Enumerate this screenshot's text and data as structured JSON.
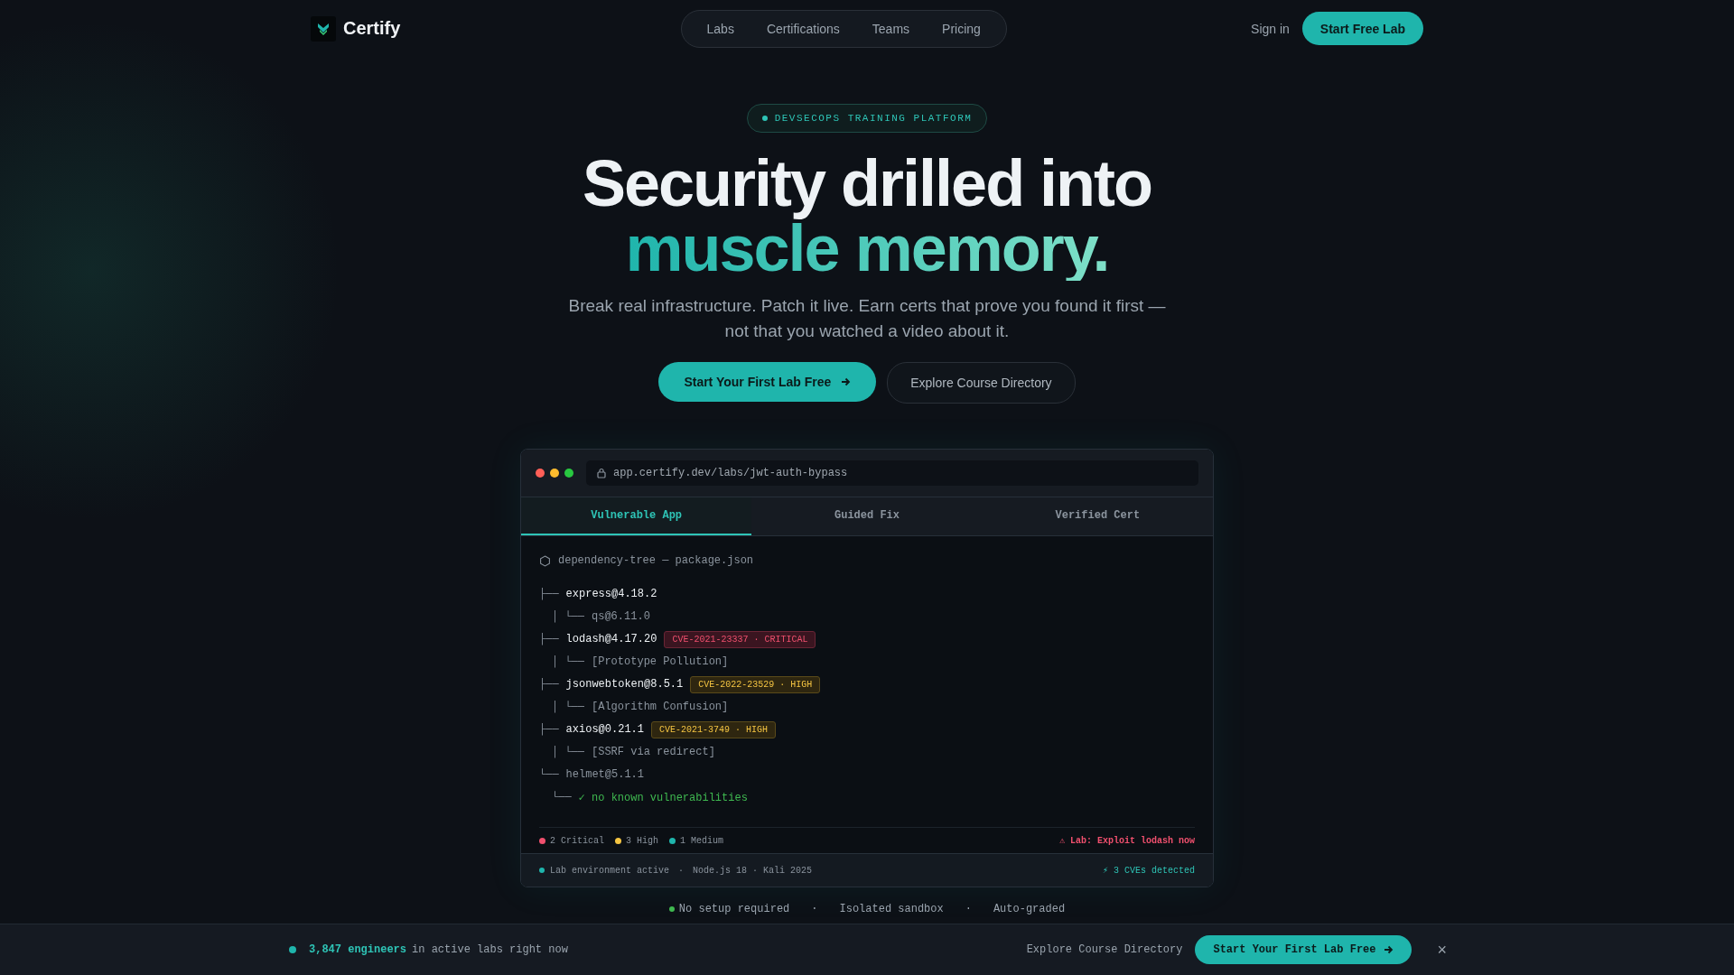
{
  "nav": {
    "brand": "Certify",
    "links": [
      "Labs",
      "Certifications",
      "Teams",
      "Pricing"
    ],
    "sign_in": "Sign in",
    "cta": "Start Free Lab"
  },
  "hero": {
    "badge": "DEVSECOPS TRAINING PLATFORM",
    "title_line1": "Security drilled into",
    "title_line2": "muscle memory.",
    "subtitle": "Break real infrastructure. Patch it live. Earn certs that prove you found it first — not that you watched a video about it.",
    "primary_button": "Start Your First Lab Free",
    "secondary_button": "Explore Course Directory"
  },
  "browser": {
    "url": "app.certify.dev/labs/jwt-auth-bypass",
    "tabs": [
      {
        "label": "Vulnerable App",
        "selected": true
      },
      {
        "label": "Guided Fix",
        "selected": false
      },
      {
        "label": "Verified Cert",
        "selected": false
      }
    ],
    "file_header": "dependency-tree — package.json",
    "tree": [
      {
        "branch": "├──",
        "name": "express@4.18.2",
        "kind": "package",
        "children": [
          {
            "branch": "│ └──",
            "name": "qs@6.11.0",
            "kind": "muted"
          }
        ]
      },
      {
        "branch": "├──",
        "name": "lodash@4.17.20",
        "kind": "package",
        "cve": {
          "label": "CVE-2021-23337 · CRITICAL",
          "kind": "critical"
        },
        "children": [
          {
            "branch": "│ └──",
            "name": "[Prototype Pollution]",
            "kind": "muted"
          }
        ]
      },
      {
        "branch": "├──",
        "name": "jsonwebtoken@8.5.1",
        "kind": "package",
        "cve": {
          "label": "CVE-2022-23529 · HIGH",
          "kind": "high"
        },
        "children": [
          {
            "branch": "│ └──",
            "name": "[Algorithm Confusion]",
            "kind": "muted"
          }
        ]
      },
      {
        "branch": "├──",
        "name": "axios@0.21.1",
        "kind": "package",
        "cve": {
          "label": "CVE-2021-3749 · HIGH",
          "kind": "high"
        },
        "children": [
          {
            "branch": "│ └──",
            "name": "[SSRF via redirect]",
            "kind": "muted"
          }
        ]
      },
      {
        "branch": "└──",
        "name": "helmet@5.1.1",
        "kind": "muted",
        "children": [
          {
            "branch": "└──",
            "name": "✓ no known vulnerabilities",
            "kind": "ok"
          }
        ]
      }
    ],
    "legend": [
      {
        "label": "2 Critical",
        "color": "#f0506e"
      },
      {
        "label": "3 High",
        "color": "#f5c542"
      },
      {
        "label": "1 Medium",
        "color": "#1fb5ac"
      }
    ],
    "lab_link": "⚠ Lab: Exploit lodash now",
    "status": {
      "env": "Lab environment active",
      "separator": "·",
      "meta": "Node.js 18 · Kali 2025",
      "cves": "⚡ 3 CVEs detected"
    }
  },
  "features": [
    {
      "label": "No setup required",
      "dot": true
    },
    {
      "label": "·",
      "dot": false
    },
    {
      "label": "Isolated sandbox",
      "dot": false
    },
    {
      "label": "·",
      "dot": false
    },
    {
      "label": "Auto-graded",
      "dot": false
    }
  ],
  "sticky_bar": {
    "count": "3,847 engineers",
    "text": "in active labs right now",
    "link": "Explore Course Directory",
    "button": "Start Your First Lab Free",
    "close": "×"
  }
}
